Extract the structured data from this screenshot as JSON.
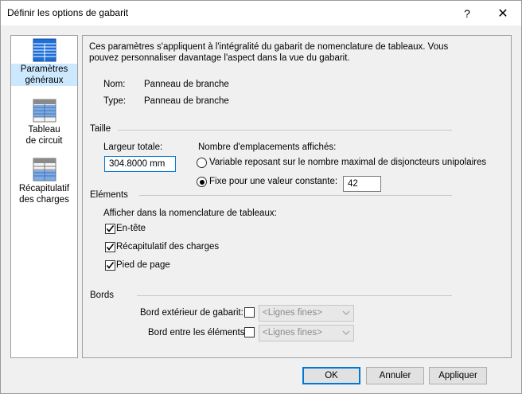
{
  "window": {
    "title": "Définir les options de gabarit",
    "help_glyph": "?",
    "close_glyph": "✕"
  },
  "sidebar": {
    "items": [
      {
        "label_line1": "Paramètres",
        "label_line2": "généraux",
        "icon": "table-grid-icon",
        "active": true
      },
      {
        "label_line1": "Tableau",
        "label_line2": "de circuit",
        "icon": "table-grid-icon",
        "active": false
      },
      {
        "label_line1": "Récapitulatif",
        "label_line2": "des charges",
        "icon": "table-grid-icon",
        "active": false
      }
    ]
  },
  "main": {
    "description_line1": "Ces paramètres s'appliquent à l'intégralité du gabarit de nomenclature de tableaux. Vous",
    "description_line2": "pouvez personnaliser davantage l'aspect dans la vue du gabarit.",
    "name_label": "Nom:",
    "name_value": "Panneau de branche",
    "type_label": "Type:",
    "type_value": "Panneau de branche",
    "size": {
      "section_label": "Taille",
      "total_width_label": "Largeur totale:",
      "total_width_value": "304.8000 mm",
      "slots_label": "Nombre d'emplacements affichés:",
      "variable_option": "Variable reposant sur le nombre maximal de disjoncteurs unipolaires",
      "fixed_option": "Fixe pour une valeur constante:",
      "fixed_value": "42",
      "selected": "fixed"
    },
    "elements": {
      "section_label": "Eléments",
      "show_label": "Afficher dans la nomenclature de tableaux:",
      "header_label": "En-tête",
      "header_checked": true,
      "load_summary_label": "Récapitulatif des charges",
      "load_summary_checked": true,
      "footer_label": "Pied de page",
      "footer_checked": true
    },
    "borders": {
      "section_label": "Bords",
      "outer_label": "Bord extérieur de gabarit:",
      "outer_checked": false,
      "outer_combo_value": "<Lignes fines>",
      "between_label": "Bord entre les éléments:",
      "between_checked": false,
      "between_combo_value": "<Lignes fines>"
    }
  },
  "buttons": {
    "ok": "OK",
    "cancel": "Annuler",
    "apply": "Appliquer"
  },
  "colors": {
    "accent": "#0078d7",
    "selection": "#cce8ff",
    "icon_blue": "#1e6fd9"
  }
}
